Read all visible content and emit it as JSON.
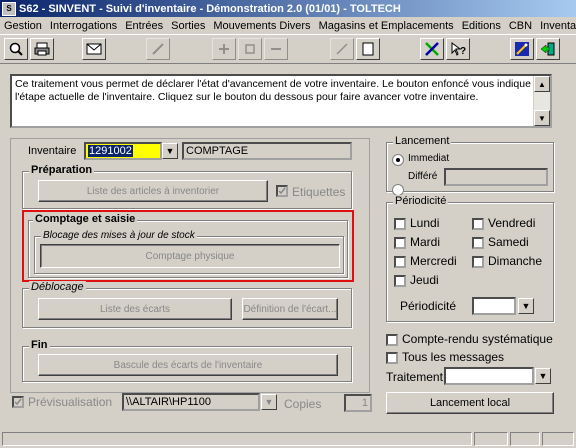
{
  "window": {
    "title": "S62 - SINVENT - Suivi d'inventaire - Démonstration 2.0 (01/01) - TOLTECH"
  },
  "menu": [
    "Gestion",
    "Interrogations",
    "Entrées",
    "Sorties",
    "Mouvements Divers",
    "Magasins et Emplacements",
    "Editions",
    "CBN",
    "Inventaires"
  ],
  "info_text": "Ce traitement vous permet de déclarer l'état d'avancement de votre inventaire. Le bouton enfoncé vous indique l'étape actuelle de l'inventaire. Cliquez sur le bouton du dessous pour faire avancer votre inventaire.",
  "inventaire": {
    "label": "Inventaire",
    "code": "1291002",
    "status": "COMPTAGE"
  },
  "preparation": {
    "title": "Préparation",
    "button": "Liste des articles à inventorier",
    "etiquettes": "Etiquettes"
  },
  "comptage": {
    "title": "Comptage et saisie",
    "subtitle": "Blocage des mises à jour de stock",
    "button": "Comptage physique"
  },
  "deblocage": {
    "title": "Déblocage",
    "liste_button": "Liste des écarts",
    "definition_button": "Définition de l'écart..."
  },
  "fin": {
    "title": "Fin",
    "button": "Bascule des écarts de l'inventaire"
  },
  "previsualisation": {
    "label": "Prévisualisation",
    "printer": "\\\\ALTAIR\\HP1100",
    "copies_label": "Copies",
    "copies": "1"
  },
  "lancement": {
    "title": "Lancement",
    "immediat": "Immediat",
    "differe": "Différé"
  },
  "periodicite": {
    "title": "Périodicité",
    "days": {
      "lundi": "Lundi",
      "mardi": "Mardi",
      "mercredi": "Mercredi",
      "jeudi": "Jeudi",
      "vendredi": "Vendredi",
      "samedi": "Samedi",
      "dimanche": "Dimanche"
    },
    "label": "Périodicité"
  },
  "options": {
    "compte_rendu": "Compte-rendu systématique",
    "tous_messages": "Tous les messages",
    "traitement": "Traitement"
  },
  "lancement_local": "Lancement local",
  "colors": {
    "title_start": "#0a246a",
    "title_end": "#a6caf0",
    "highlight_box": "#e01010",
    "code_bg": "#ffff00"
  }
}
